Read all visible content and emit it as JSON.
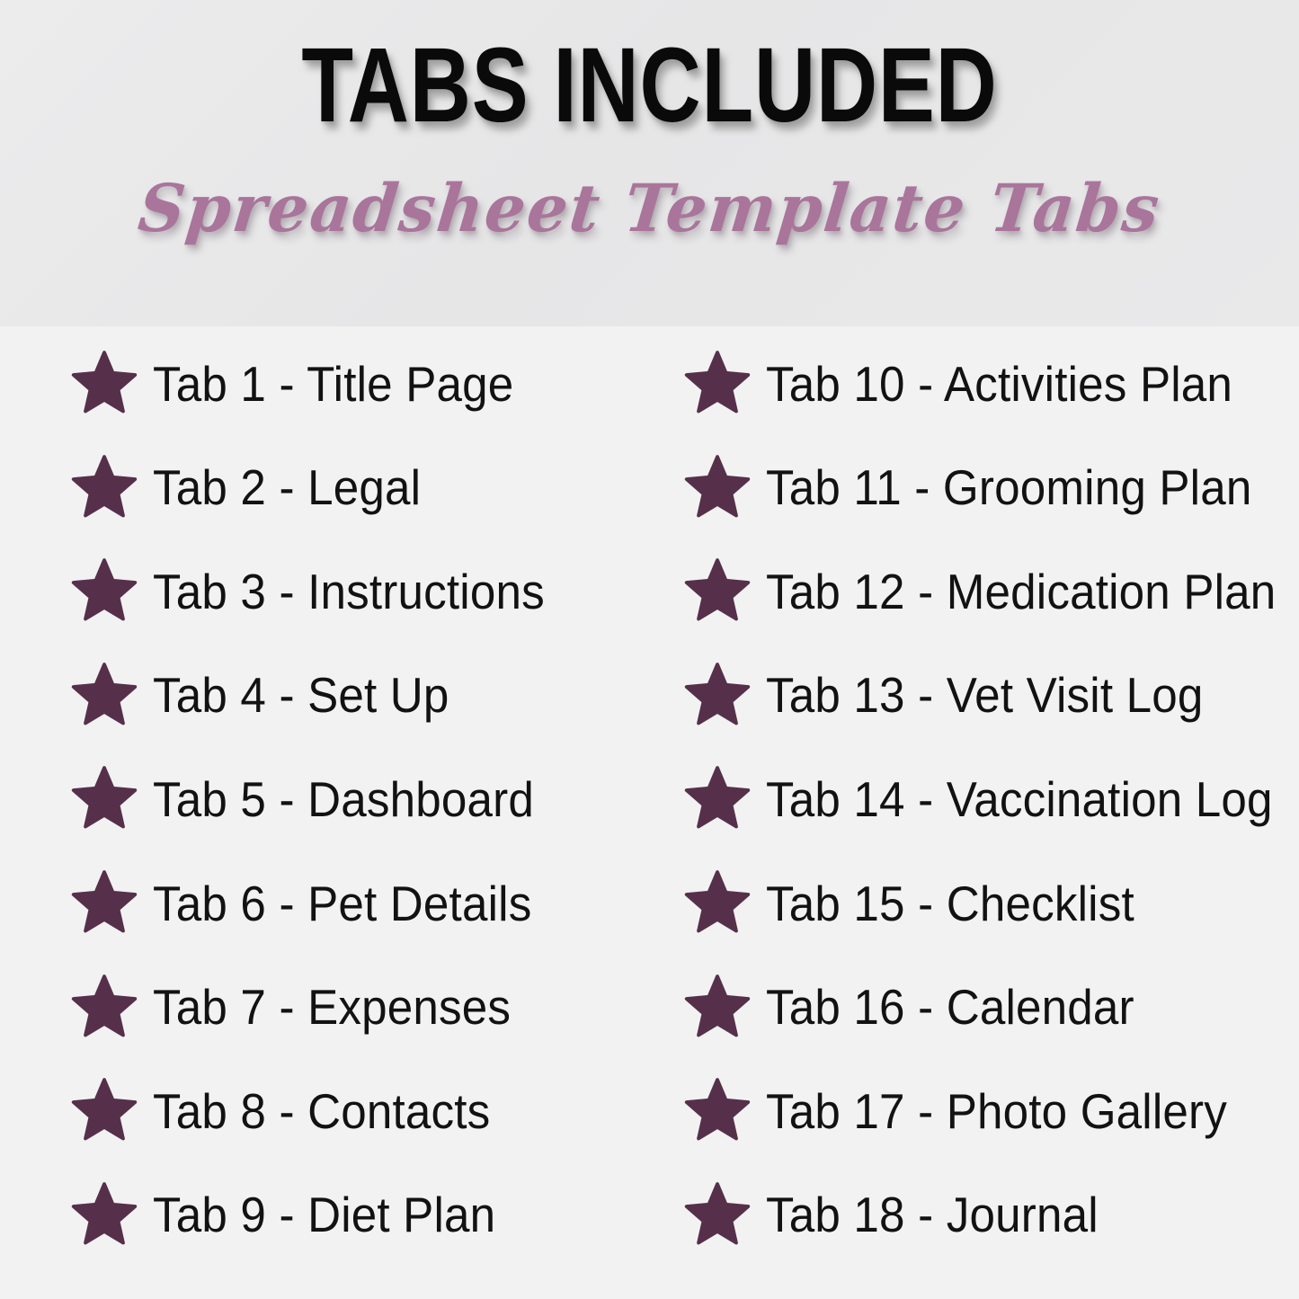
{
  "page": {
    "background_color": "#f2f2f2",
    "header_background_color": "#e7e7e8"
  },
  "header": {
    "title": "TABS INCLUDED",
    "subtitle": "Spreadsheet Template Tabs",
    "title_color": "#0a0a0a",
    "subtitle_color": "#a9759b"
  },
  "icons": {
    "bullet": "star-icon",
    "bullet_color": "#56304a"
  },
  "tabs": {
    "left_column": [
      {
        "label": "Tab 1 - Title Page",
        "number": "1",
        "name": "Title Page"
      },
      {
        "label": "Tab 2 - Legal",
        "number": "2",
        "name": "Legal"
      },
      {
        "label": "Tab 3 - Instructions",
        "number": "3",
        "name": "Instructions"
      },
      {
        "label": "Tab 4 - Set Up",
        "number": "4",
        "name": "Set Up"
      },
      {
        "label": "Tab 5 - Dashboard",
        "number": "5",
        "name": "Dashboard"
      },
      {
        "label": "Tab 6 - Pet Details",
        "number": "6",
        "name": "Pet Details"
      },
      {
        "label": "Tab 7 - Expenses",
        "number": "7",
        "name": "Expenses"
      },
      {
        "label": "Tab 8 - Contacts",
        "number": "8",
        "name": "Contacts"
      },
      {
        "label": "Tab 9 - Diet Plan",
        "number": "9",
        "name": "Diet Plan"
      }
    ],
    "right_column": [
      {
        "label": "Tab 10 - Activities Plan",
        "number": "10",
        "name": "Activities Plan"
      },
      {
        "label": "Tab 11 - Grooming Plan",
        "number": "11",
        "name": "Grooming Plan"
      },
      {
        "label": "Tab 12 - Medication Plan",
        "number": "12",
        "name": "Medication Plan"
      },
      {
        "label": "Tab 13 - Vet Visit Log",
        "number": "13",
        "name": "Vet Visit Log"
      },
      {
        "label": "Tab 14 - Vaccination Log",
        "number": "14",
        "name": "Vaccination Log"
      },
      {
        "label": "Tab 15 - Checklist",
        "number": "15",
        "name": "Checklist"
      },
      {
        "label": "Tab 16 - Calendar",
        "number": "16",
        "name": "Calendar"
      },
      {
        "label": "Tab 17 - Photo Gallery",
        "number": "17",
        "name": "Photo Gallery"
      },
      {
        "label": "Tab 18 - Journal",
        "number": "18",
        "name": "Journal"
      }
    ]
  }
}
